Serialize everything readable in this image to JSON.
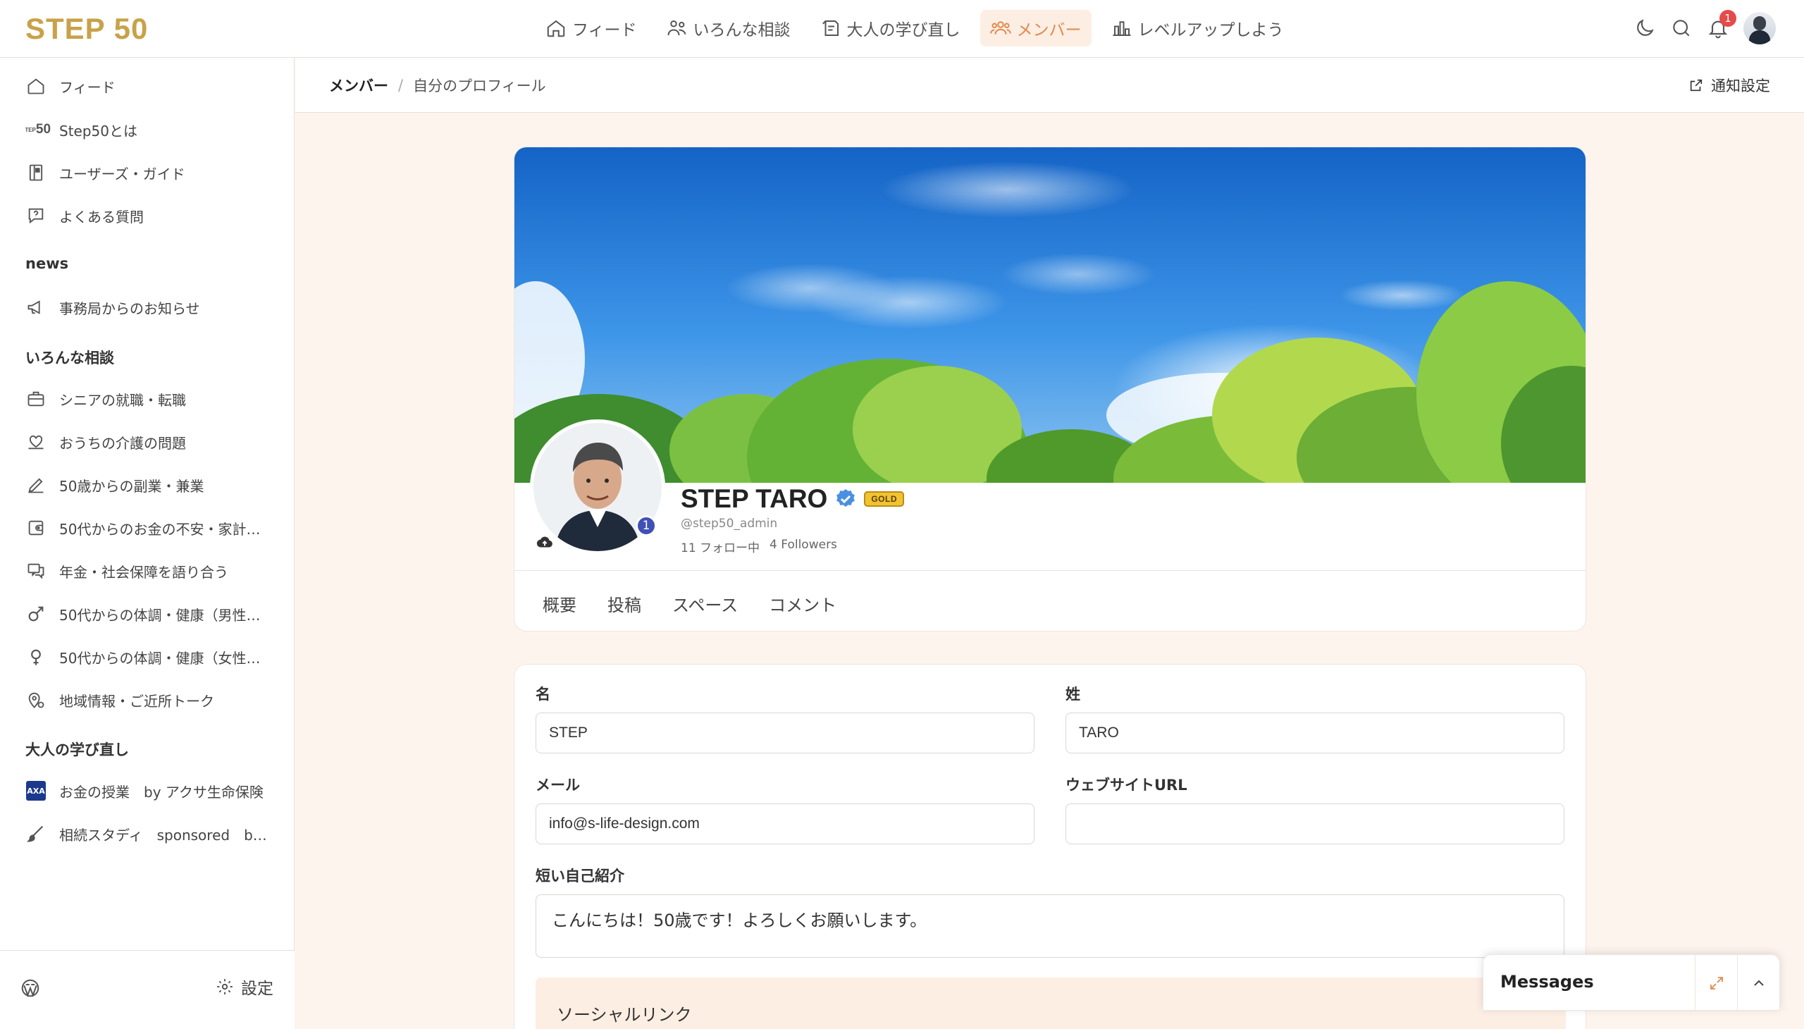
{
  "brand": {
    "logo_text": "STEP 50",
    "accent": "#c8a24a",
    "nav_active_color": "#e08a4e"
  },
  "topnav": {
    "items": [
      {
        "label": "フィード",
        "icon": "home-icon"
      },
      {
        "label": "いろんな相談",
        "icon": "people-icon"
      },
      {
        "label": "大人の学び直し",
        "icon": "notebook-icon"
      },
      {
        "label": "メンバー",
        "icon": "members-icon",
        "active": true
      },
      {
        "label": "レベルアップしよう",
        "icon": "chart-icon"
      }
    ],
    "notification_count": "1"
  },
  "sidebar": {
    "top_items": [
      {
        "label": "フィード",
        "icon": "home-icon"
      },
      {
        "label": "Step50とは",
        "icon": "step50-logo-icon",
        "icon_text": "STEP\n50"
      },
      {
        "label": "ユーザーズ・ガイド",
        "icon": "guide-book-icon"
      },
      {
        "label": "よくある質問",
        "icon": "question-bubble-icon"
      }
    ],
    "sections": [
      {
        "heading": "news",
        "items": [
          {
            "label": "事務局からのお知らせ",
            "icon": "megaphone-icon"
          }
        ]
      },
      {
        "heading": "いろんな相談",
        "items": [
          {
            "label": "シニアの就職・転職",
            "icon": "briefcase-icon"
          },
          {
            "label": "おうちの介護の問題",
            "icon": "care-heart-icon"
          },
          {
            "label": "50歳からの副業・兼業",
            "icon": "pen-icon"
          },
          {
            "label": "50代からのお金の不安・家計…",
            "icon": "wallet-icon"
          },
          {
            "label": "年金・社会保障を語り合う",
            "icon": "chat-icon"
          },
          {
            "label": "50代からの体調・健康（男性…",
            "icon": "male-icon"
          },
          {
            "label": "50代からの体調・健康（女性…",
            "icon": "female-icon"
          },
          {
            "label": "地域情報・ご近所トーク",
            "icon": "location-icon"
          }
        ]
      },
      {
        "heading": "大人の学び直し",
        "items": [
          {
            "label": "お金の授業　by アクサ生命保険",
            "icon": "axa-logo-icon",
            "icon_text": "AXA"
          },
          {
            "label": "相続スタディ　sponsored　b…",
            "icon": "brush-icon"
          }
        ]
      }
    ],
    "footer": {
      "settings_label": "設定"
    }
  },
  "breadcrumb": {
    "root": "メンバー",
    "separator": "/",
    "current": "自分のプロフィール",
    "notify_label": "通知設定"
  },
  "profile": {
    "name": "STEP TARO",
    "badge": "GOLD",
    "handle": "@step50_admin",
    "following_count": "11",
    "following_label": "フォロー中",
    "followers_count": "4",
    "followers_label": "Followers",
    "level": "1",
    "tabs": [
      "概要",
      "投稿",
      "スペース",
      "コメント"
    ]
  },
  "form": {
    "first_name_label": "名",
    "first_name_value": "STEP",
    "last_name_label": "姓",
    "last_name_value": "TARO",
    "email_label": "メール",
    "email_value": "info@s-life-design.com",
    "website_label": "ウェブサイトURL",
    "website_value": "",
    "bio_label": "短い自己紹介",
    "bio_value": "こんにちは！50歳です！よろしくお願いします。",
    "social_label": "ソーシャルリンク"
  },
  "messages": {
    "title": "Messages"
  }
}
